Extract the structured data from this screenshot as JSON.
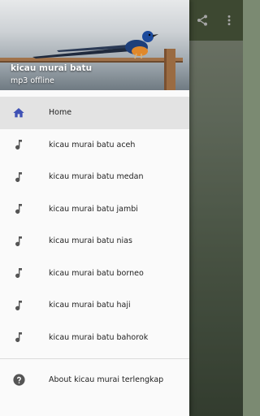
{
  "header": {
    "title": "kicau murai batu",
    "subtitle": "mp3 offline"
  },
  "toolbar": {
    "share_icon": "share-icon",
    "more_icon": "more-vert-icon",
    "color": "#5f6f4c"
  },
  "menu": {
    "items": [
      {
        "label": "Home",
        "icon": "home-icon",
        "active": true
      },
      {
        "label": "kicau murai batu aceh",
        "icon": "music-note-icon"
      },
      {
        "label": "kicau murai batu medan",
        "icon": "music-note-icon"
      },
      {
        "label": "kicau murai batu jambi",
        "icon": "music-note-icon"
      },
      {
        "label": "kicau murai batu nias",
        "icon": "music-note-icon"
      },
      {
        "label": "kicau murai batu borneo",
        "icon": "music-note-icon"
      },
      {
        "label": "kicau murai batu haji",
        "icon": "music-note-icon"
      },
      {
        "label": "kicau murai batu bahorok",
        "icon": "music-note-icon"
      }
    ],
    "about": {
      "label": "About kicau murai terlengkap",
      "icon": "help-icon"
    }
  },
  "colors": {
    "accent": "#3f51b5",
    "icon_gray": "#555555",
    "active_bg": "#e3e3e3"
  }
}
